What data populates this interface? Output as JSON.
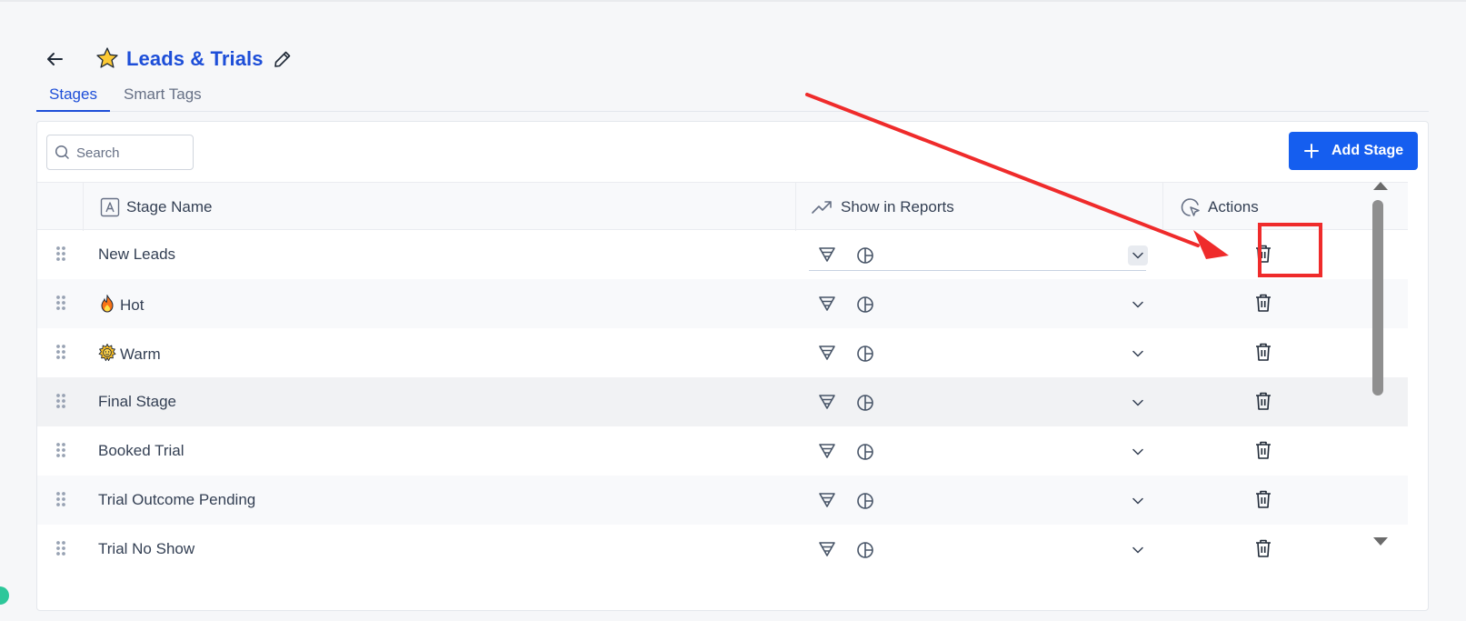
{
  "header": {
    "title": "Leads & Trials"
  },
  "tabs": [
    {
      "label": "Stages",
      "active": true
    },
    {
      "label": "Smart Tags",
      "active": false
    }
  ],
  "toolbar": {
    "search_placeholder": "Search",
    "add_button_label": "Add Stage"
  },
  "table": {
    "columns": {
      "name": "Stage Name",
      "reports": "Show in Reports",
      "actions": "Actions"
    },
    "rows": [
      {
        "name": "New Leads",
        "emoji": null
      },
      {
        "name": "Hot",
        "emoji": "fire-icon"
      },
      {
        "name": "Warm",
        "emoji": "sun-icon"
      },
      {
        "name": "Final Stage",
        "emoji": null
      },
      {
        "name": "Booked Trial",
        "emoji": null
      },
      {
        "name": "Trial Outcome Pending",
        "emoji": null
      },
      {
        "name": "Trial No Show",
        "emoji": null
      }
    ]
  },
  "colors": {
    "accent": "#1d4ed8",
    "button": "#155eef",
    "annotation": "#ef2b2b"
  }
}
